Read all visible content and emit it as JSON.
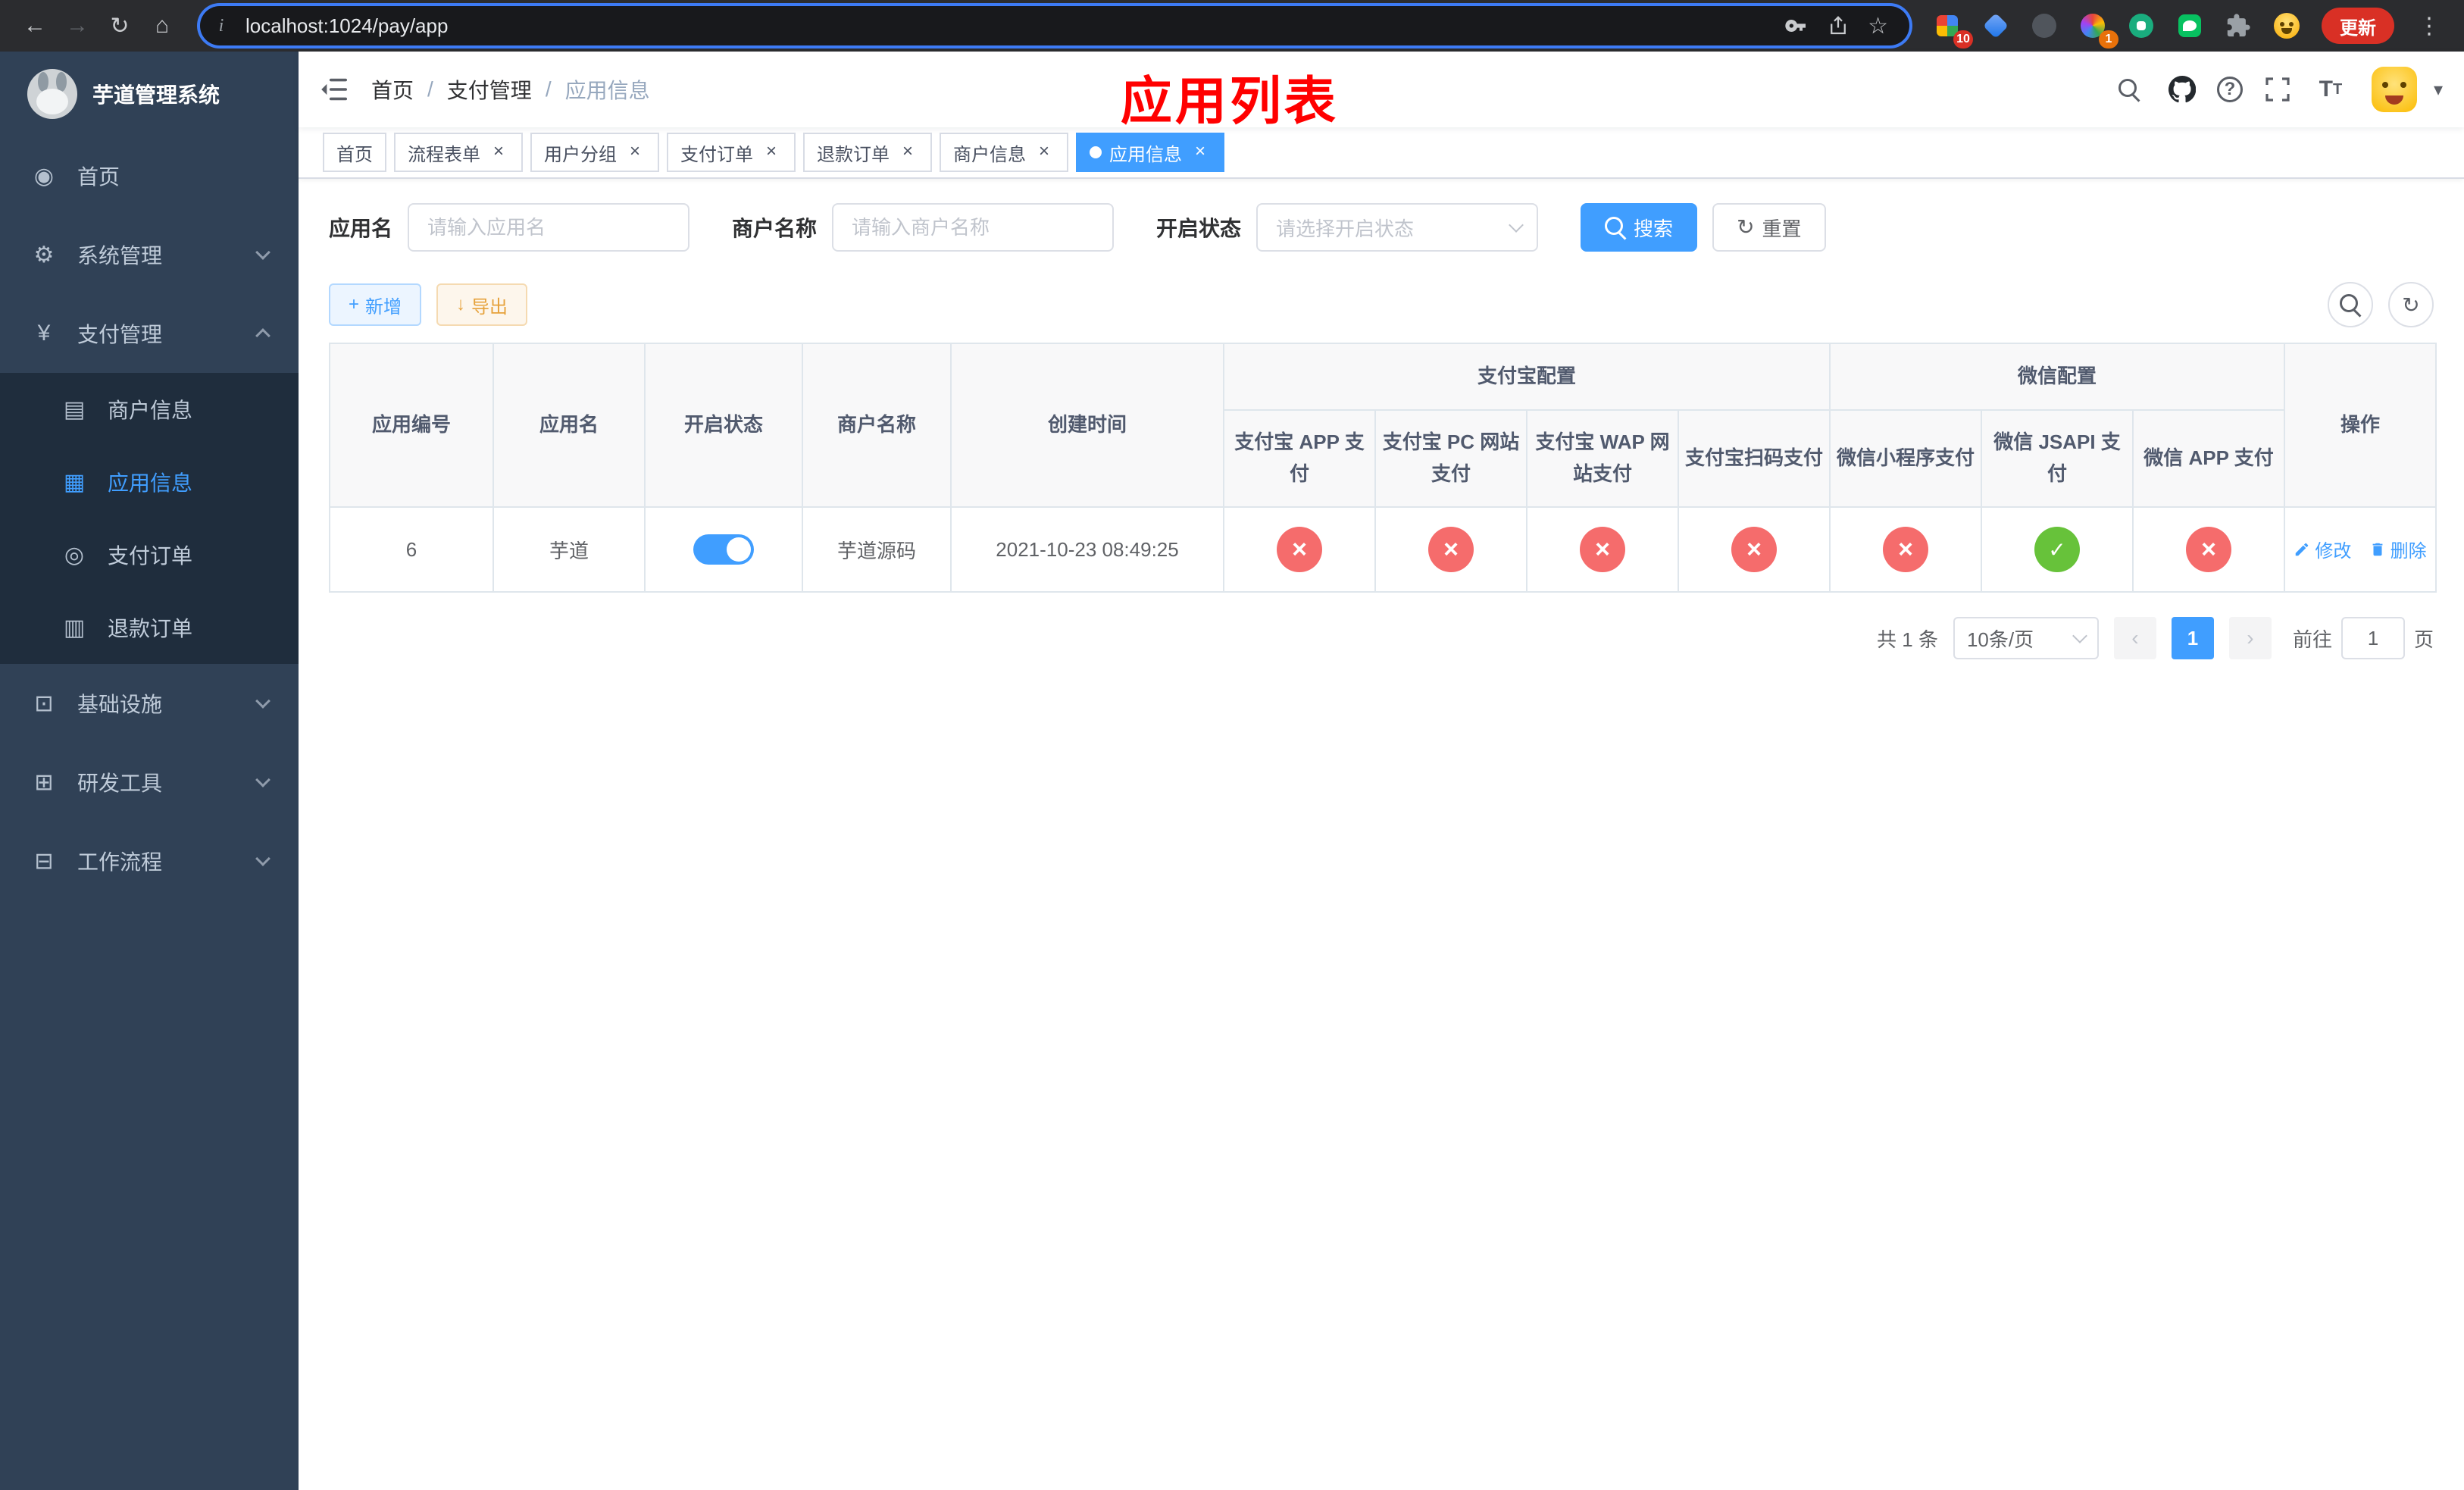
{
  "browser": {
    "url": "localhost:1024/pay/app",
    "update_label": "更新",
    "ext_badge_grid": "10",
    "ext_badge_rainbow": "1"
  },
  "sidebar": {
    "title": "芋道管理系统",
    "menu": [
      {
        "label": "首页"
      },
      {
        "label": "系统管理"
      },
      {
        "label": "支付管理"
      },
      {
        "label": "基础设施"
      },
      {
        "label": "研发工具"
      },
      {
        "label": "工作流程"
      }
    ],
    "submenu": [
      {
        "label": "商户信息"
      },
      {
        "label": "应用信息"
      },
      {
        "label": "支付订单"
      },
      {
        "label": "退款订单"
      }
    ]
  },
  "header": {
    "breadcrumb": [
      "首页",
      "支付管理",
      "应用信息"
    ],
    "annotation": "应用列表"
  },
  "tabs": [
    {
      "label": "首页",
      "closable": false,
      "active": false
    },
    {
      "label": "流程表单",
      "closable": true,
      "active": false
    },
    {
      "label": "用户分组",
      "closable": true,
      "active": false
    },
    {
      "label": "支付订单",
      "closable": true,
      "active": false
    },
    {
      "label": "退款订单",
      "closable": true,
      "active": false
    },
    {
      "label": "商户信息",
      "closable": true,
      "active": false
    },
    {
      "label": "应用信息",
      "closable": true,
      "active": true
    }
  ],
  "filters": {
    "app_name": {
      "label": "应用名",
      "placeholder": "请输入应用名",
      "value": ""
    },
    "merchant_name": {
      "label": "商户名称",
      "placeholder": "请输入商户名称",
      "value": ""
    },
    "status": {
      "label": "开启状态",
      "placeholder": "请选择开启状态"
    },
    "search_label": "搜索",
    "reset_label": "重置"
  },
  "toolbar": {
    "add_label": "新增",
    "export_label": "导出"
  },
  "table": {
    "columns": [
      "应用编号",
      "应用名",
      "开启状态",
      "商户名称",
      "创建时间"
    ],
    "groups": {
      "alipay": "支付宝配置",
      "wechat": "微信配置"
    },
    "sub_columns": [
      "支付宝 APP 支付",
      "支付宝 PC 网站支付",
      "支付宝 WAP 网站支付",
      "支付宝扫码支付",
      "微信小程序支付",
      "微信 JSAPI 支付",
      "微信 APP 支付"
    ],
    "actions_column": "操作",
    "row": {
      "id": "6",
      "name": "芋道",
      "enabled": true,
      "merchant": "芋道源码",
      "created": "2021-10-23 08:49:25",
      "statuses": [
        "x",
        "x",
        "x",
        "x",
        "x",
        "check",
        "x"
      ],
      "edit_label": "修改",
      "delete_label": "删除"
    }
  },
  "pagination": {
    "total": "共 1 条",
    "page_size": "10条/页",
    "current_page": "1",
    "goto_prefix": "前往",
    "goto_value": "1",
    "goto_suffix": "页"
  },
  "colors": {
    "primary": "#409eff",
    "success": "#67c23a",
    "danger": "#f56c6c",
    "sidebar_bg": "#304156",
    "submenu_bg": "#1f2d3d",
    "annotation": "#ff0000"
  }
}
